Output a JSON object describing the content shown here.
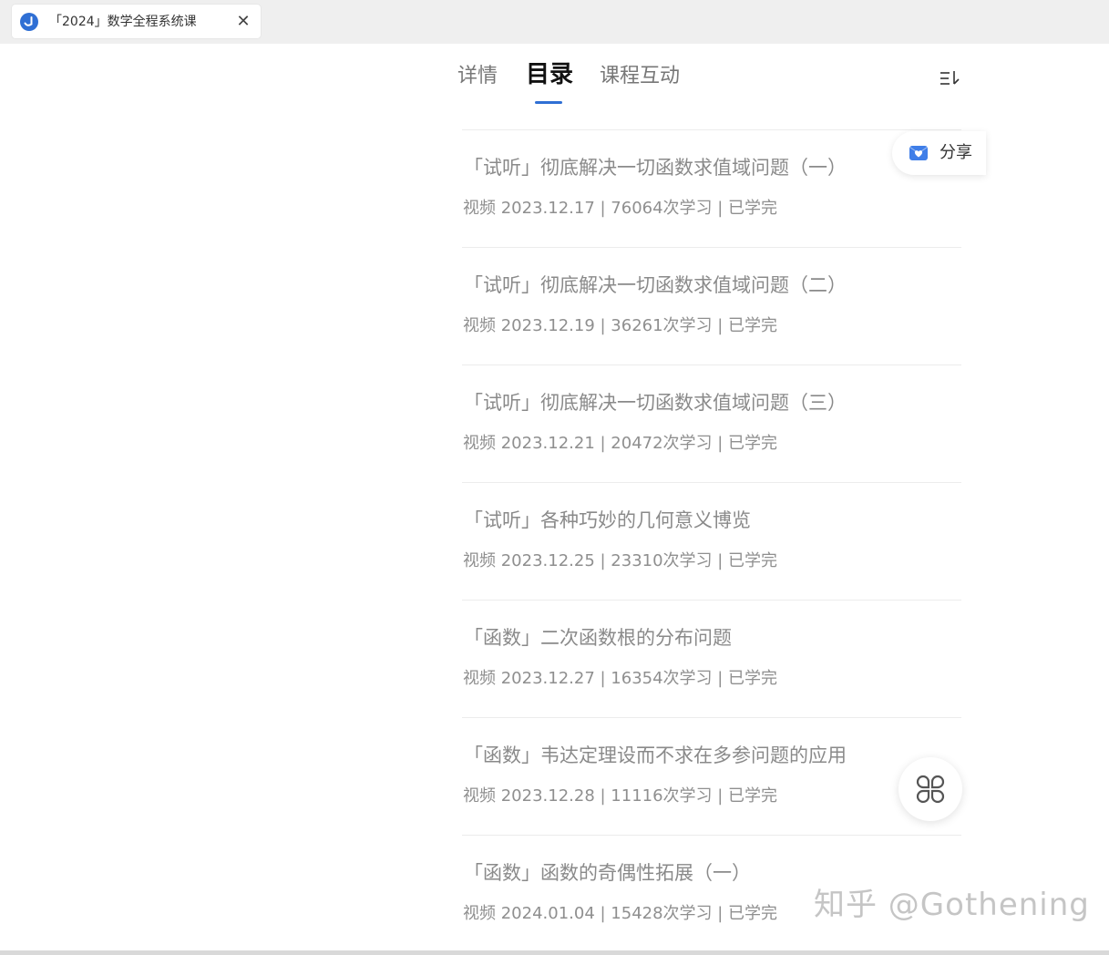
{
  "browser": {
    "tab_title": "「2024」数学全程系统课",
    "close_glyph": "✕"
  },
  "content_tabs": [
    {
      "label": "详情",
      "active": false
    },
    {
      "label": "目录",
      "active": true
    },
    {
      "label": "课程互动",
      "active": false
    }
  ],
  "accent_color": "#2f6fd4",
  "share": {
    "label": "分享"
  },
  "lessons": [
    {
      "title": "「试听」彻底解决一切函数求值域问题（一）",
      "meta": "视频  2023.12.17 | 76064次学习 | 已学完"
    },
    {
      "title": "「试听」彻底解决一切函数求值域问题（二）",
      "meta": "视频  2023.12.19 | 36261次学习 | 已学完"
    },
    {
      "title": "「试听」彻底解决一切函数求值域问题（三）",
      "meta": "视频  2023.12.21 | 20472次学习 | 已学完"
    },
    {
      "title": "「试听」各种巧妙的几何意义博览",
      "meta": "视频  2023.12.25 | 23310次学习 | 已学完"
    },
    {
      "title": "「函数」二次函数根的分布问题",
      "meta": "视频  2023.12.27 | 16354次学习 | 已学完"
    },
    {
      "title": "「函数」韦达定理设而不求在多参问题的应用",
      "meta": "视频  2023.12.28 | 11116次学习 | 已学完"
    },
    {
      "title": "「函数」函数的奇偶性拓展（一）",
      "meta": "视频  2024.01.04 | 15428次学习 | 已学完"
    }
  ],
  "watermark": "知乎 @Gothening"
}
